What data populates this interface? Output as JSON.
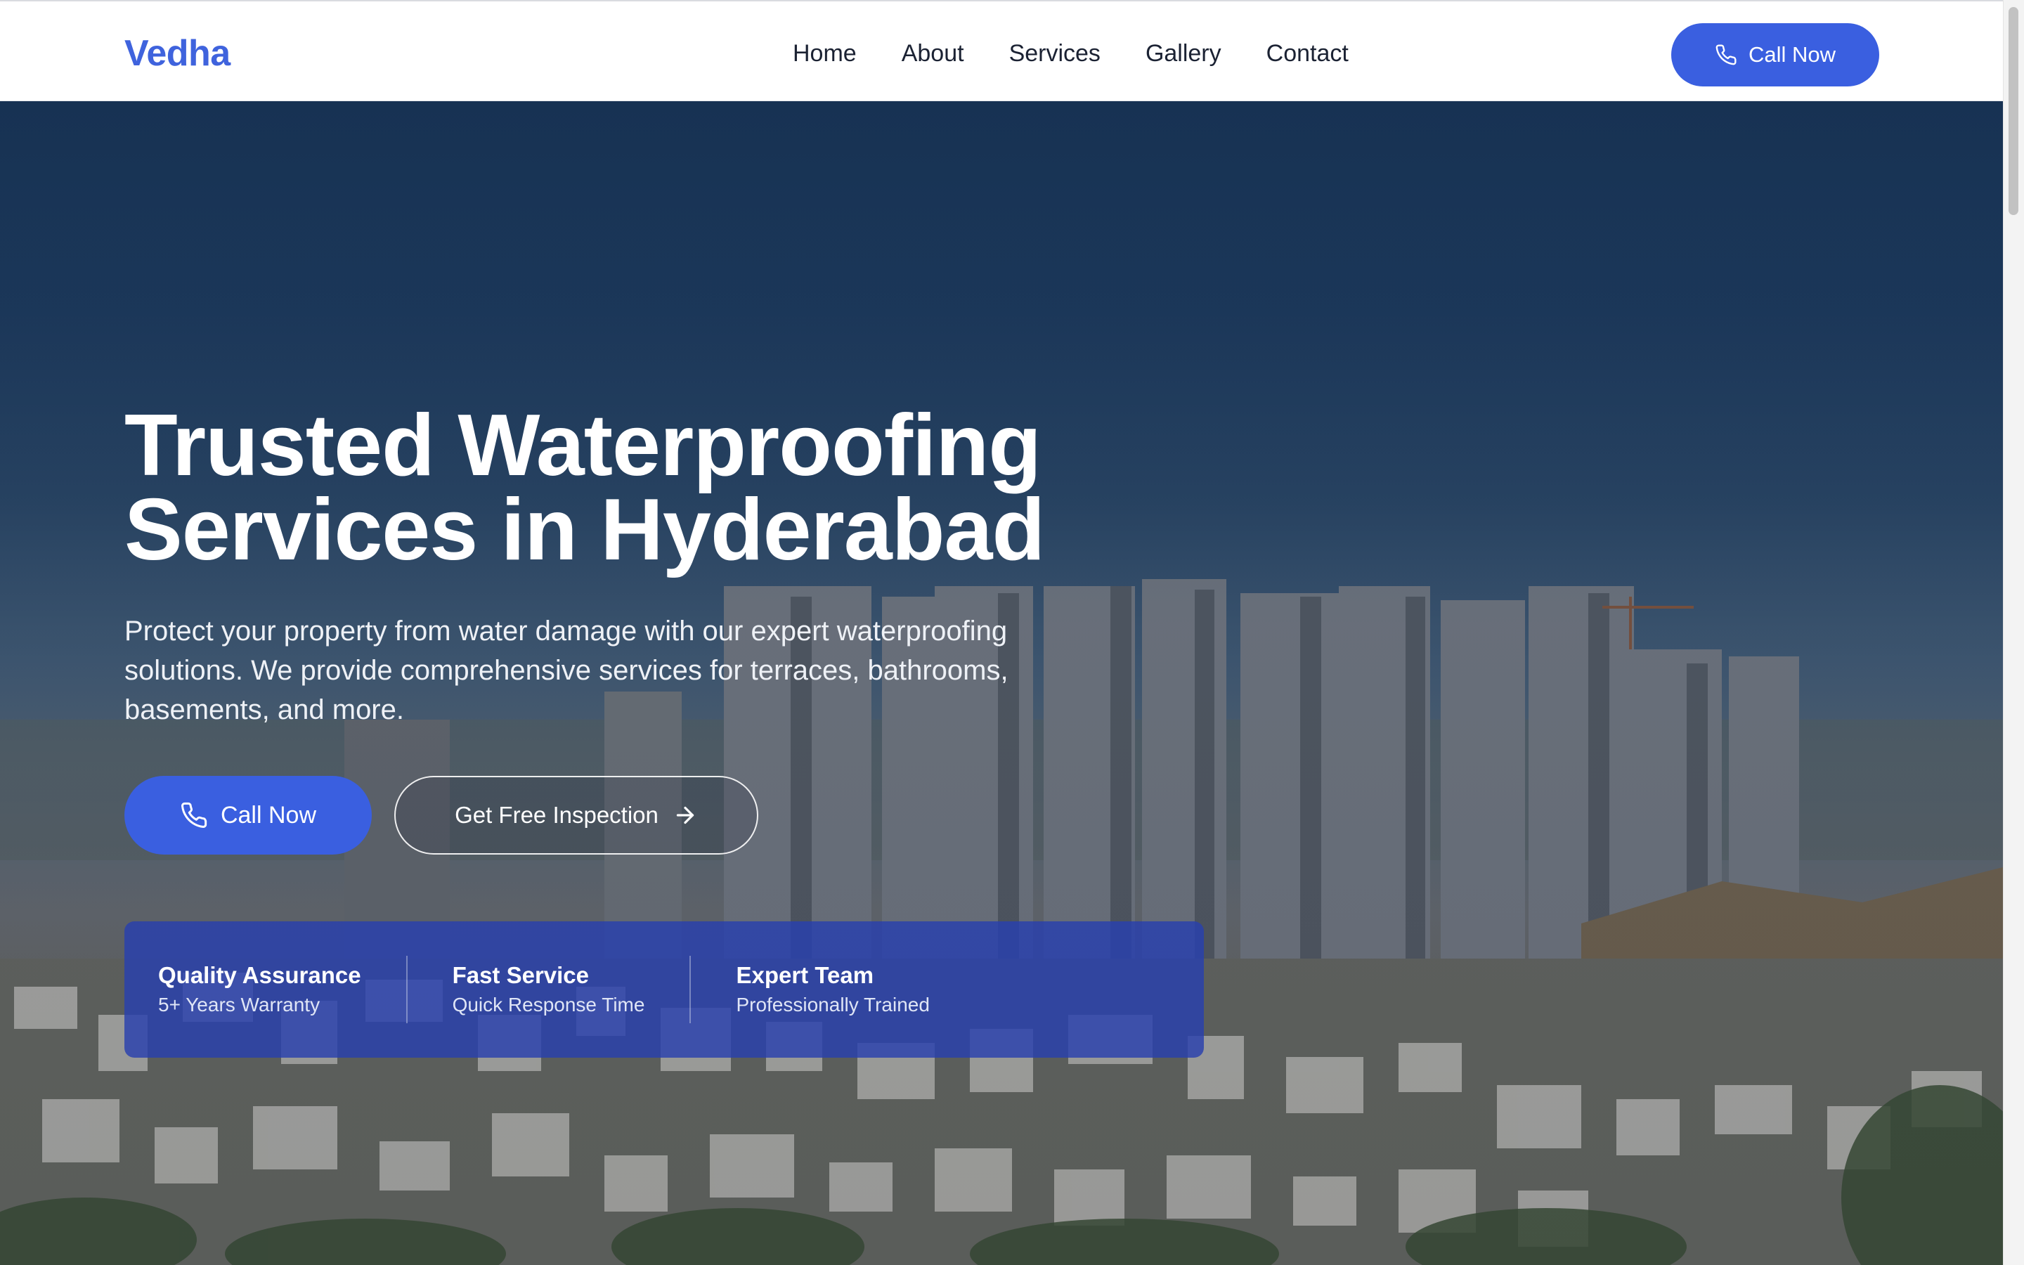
{
  "header": {
    "logo": "Vedha",
    "nav": [
      "Home",
      "About",
      "Services",
      "Gallery",
      "Contact"
    ],
    "call_label": "Call Now"
  },
  "hero": {
    "title_line1": "Trusted Waterproofing",
    "title_line2": "Services in Hyderabad",
    "subtitle": "Protect your property from water damage with our expert waterproofing solutions. We provide comprehensive services for terraces, bathrooms, basements, and more.",
    "call_label": "Call Now",
    "inspection_label": "Get Free Inspection",
    "background_image": "city-skyline-photo"
  },
  "features": [
    {
      "title": "Quality Assurance",
      "desc": "5+ Years Warranty"
    },
    {
      "title": "Fast Service",
      "desc": "Quick Response Time"
    },
    {
      "title": "Expert Team",
      "desc": "Professionally Trained"
    }
  ],
  "colors": {
    "accent": "#3a5fe0",
    "logo": "#3f63dd",
    "feature_panel": "#2840af"
  },
  "icons": {
    "call": "phone-icon",
    "inspection": "arrow-right-icon"
  }
}
